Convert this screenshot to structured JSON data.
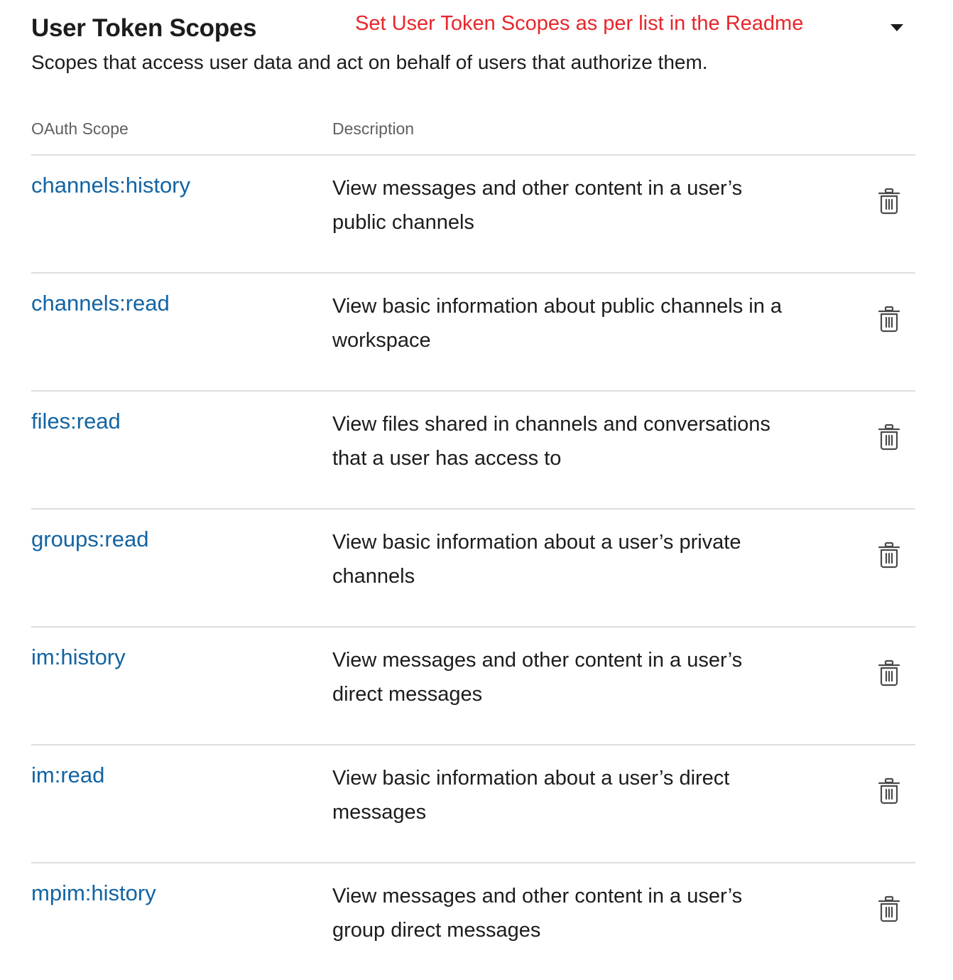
{
  "section": {
    "title": "User Token Scopes",
    "annotation": "Set User Token Scopes as per list in the Readme",
    "subtitle": "Scopes that access user data and act on behalf of users that authorize them.",
    "colors": {
      "annotation": "#e8262b",
      "link": "#1264a3",
      "muted": "#616061",
      "divider": "#dddddd"
    }
  },
  "table": {
    "headers": {
      "scope": "OAuth Scope",
      "description": "Description"
    },
    "rows": [
      {
        "scope": "channels:history",
        "description": "View messages and other content in a user’s public channels",
        "action_icon": "trash-icon"
      },
      {
        "scope": "channels:read",
        "description": "View basic information about public channels in a workspace",
        "action_icon": "trash-icon"
      },
      {
        "scope": "files:read",
        "description": "View files shared in channels and conversations that a user has access to",
        "action_icon": "trash-icon"
      },
      {
        "scope": "groups:read",
        "description": "View basic information about a user’s private channels",
        "action_icon": "trash-icon"
      },
      {
        "scope": "im:history",
        "description": "View messages and other content in a user’s direct messages",
        "action_icon": "trash-icon"
      },
      {
        "scope": "im:read",
        "description": "View basic information about a user’s direct messages",
        "action_icon": "trash-icon"
      },
      {
        "scope": "mpim:history",
        "description": "View messages and other content in a user’s group direct messages",
        "action_icon": "trash-icon"
      }
    ]
  }
}
